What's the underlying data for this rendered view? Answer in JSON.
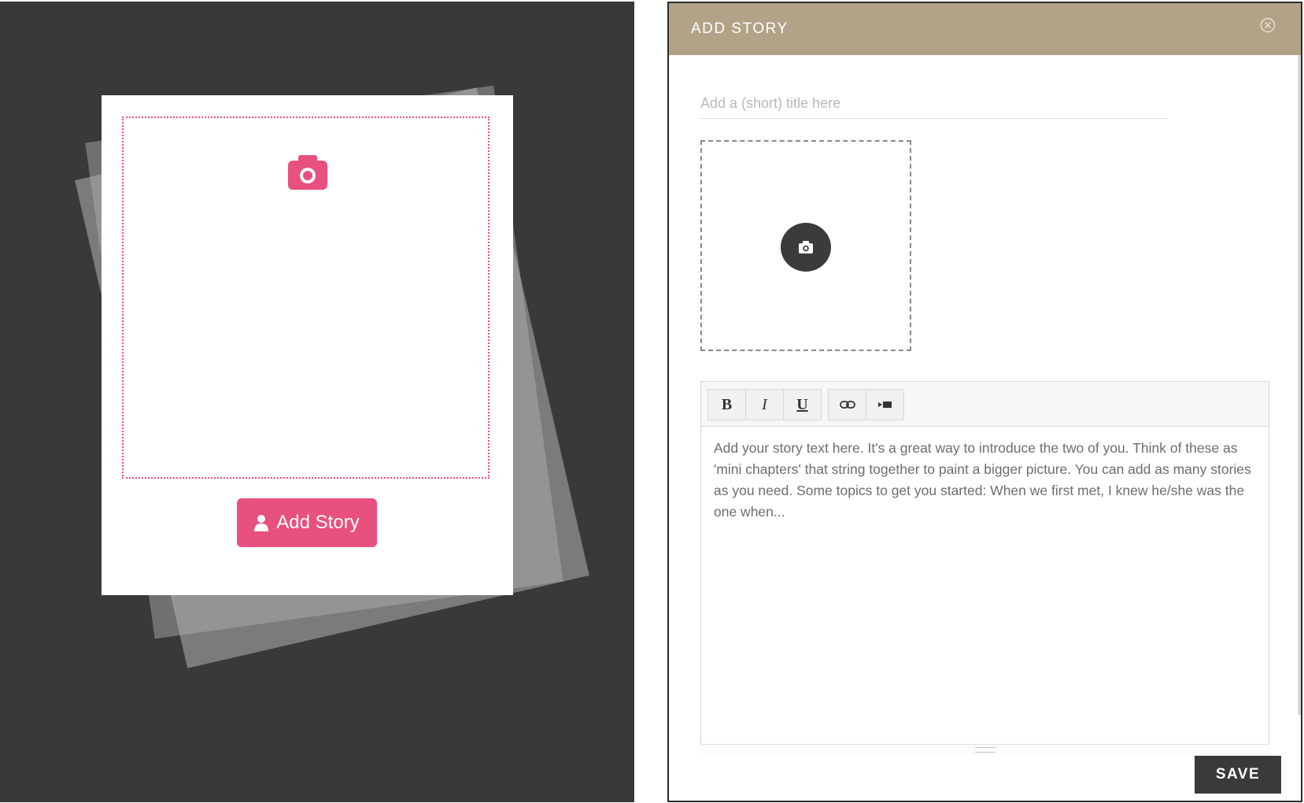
{
  "left_panel": {
    "add_story_label": "Add Story",
    "accent_color": "#e8507e"
  },
  "modal": {
    "title": "ADD STORY",
    "title_placeholder": "Add a (short) title here",
    "story_text": "Add your story text here. It's a great way to introduce the two of you. Think of these as 'mini chapters' that string together to paint a bigger picture. You can add as many stories as you need. Some topics to get you started: When we first met, I knew he/she was the one when...",
    "save_label": "SAVE",
    "header_color": "#b2a388",
    "toolbar": {
      "bold": "B",
      "italic": "I",
      "underline": "U"
    }
  }
}
